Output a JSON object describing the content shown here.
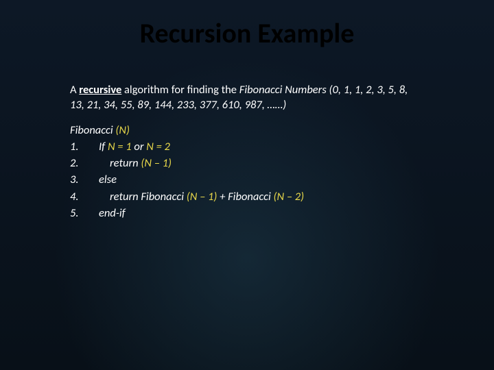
{
  "title": "Recursion Example",
  "intro": {
    "prefix": "A ",
    "recursive": "recursive",
    "mid": " algorithm for finding the ",
    "series": "Fibonacci Numbers (0, 1, 1, 2, 3, 5, 8, 13, 21, 34, 55, 89, 144, 233, 377, 610, 987, ……)"
  },
  "algo": {
    "name": "Fibonacci ",
    "arg": "(N)",
    "steps": {
      "n1": "1.",
      "s1a": "If ",
      "s1b": "N = 1",
      "s1c": " or  ",
      "s1d": "N = 2",
      "n2": "2.",
      "s2a": " return ",
      "s2b": "(N – 1)",
      "n3": "3.",
      "s3": "else",
      "n4": "4.",
      "s4a": " return Fibonacci ",
      "s4b": "(N – 1) ",
      "s4c": "+ Fibonacci ",
      "s4d": "(N – 2)",
      "n5": "5.",
      "s5": "end-if"
    }
  }
}
